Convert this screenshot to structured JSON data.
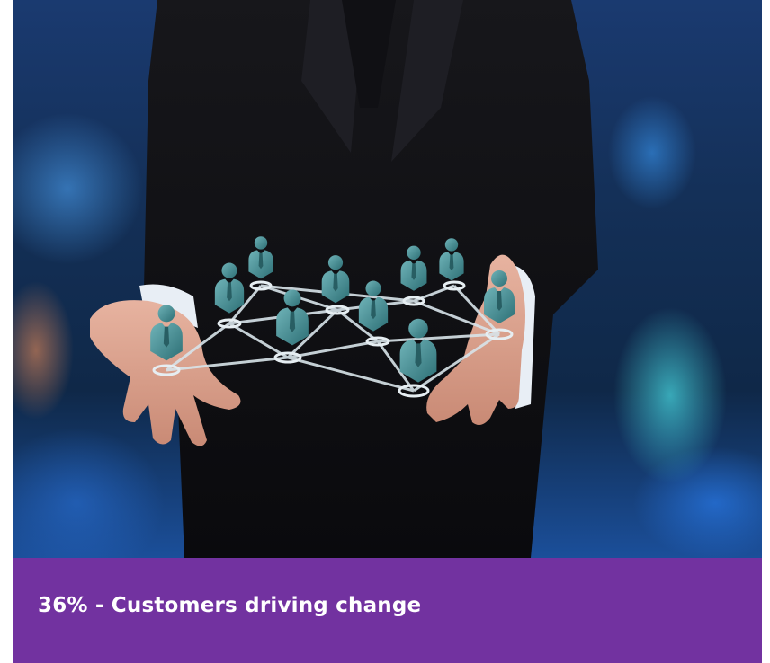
{
  "card": {
    "caption": "36% - Customers driving change"
  },
  "colors": {
    "banner": "#7232a0",
    "caption_text": "#ffffff",
    "figure_teal": "#3f8f95"
  },
  "hero": {
    "icon": "businessman-network-image"
  }
}
